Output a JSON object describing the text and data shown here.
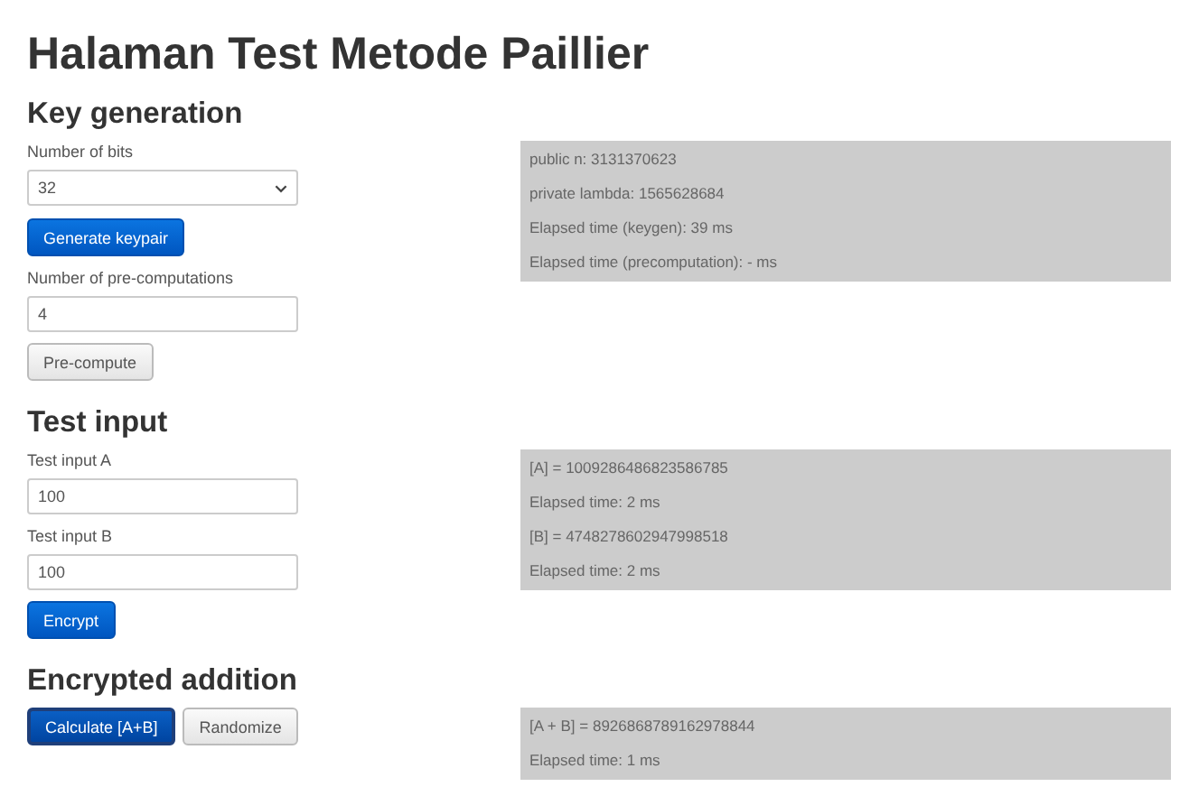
{
  "title": "Halaman Test Metode Paillier",
  "sections": [
    {
      "heading": "Key generation",
      "controls": [
        {
          "kind": "label",
          "text": "Number of bits"
        },
        {
          "kind": "select",
          "value": "32"
        },
        {
          "kind": "buttons",
          "buttons": [
            {
              "label": "Generate keypair",
              "kind": "primary",
              "focused": false
            }
          ]
        },
        {
          "kind": "label",
          "text": "Number of pre-computations"
        },
        {
          "kind": "input",
          "value": "4"
        },
        {
          "kind": "buttons",
          "buttons": [
            {
              "label": "Pre-compute",
              "kind": "default",
              "focused": false
            }
          ]
        }
      ],
      "output": [
        "public n: 3131370623",
        "private lambda: 1565628684",
        "Elapsed time (keygen): 39 ms",
        "Elapsed time (precomputation): - ms"
      ]
    },
    {
      "heading": "Test input",
      "controls": [
        {
          "kind": "label",
          "text": "Test input A"
        },
        {
          "kind": "input",
          "value": "100"
        },
        {
          "kind": "label",
          "text": "Test input B"
        },
        {
          "kind": "input",
          "value": "100"
        },
        {
          "kind": "buttons",
          "buttons": [
            {
              "label": "Encrypt",
              "kind": "primary",
              "focused": false
            }
          ]
        }
      ],
      "output": [
        "[A] = 1009286486823586785",
        "Elapsed time: 2 ms",
        "[B] = 4748278602947998518",
        "Elapsed time: 2 ms"
      ]
    },
    {
      "heading": "Encrypted addition",
      "controls": [
        {
          "kind": "buttons",
          "buttons": [
            {
              "label": "Calculate [A+B]",
              "kind": "primary",
              "focused": true
            },
            {
              "label": "Randomize",
              "kind": "default",
              "focused": false
            }
          ]
        }
      ],
      "output": [
        "[A + B] = 8926868789162978844",
        "Elapsed time: 1 ms"
      ]
    }
  ]
}
